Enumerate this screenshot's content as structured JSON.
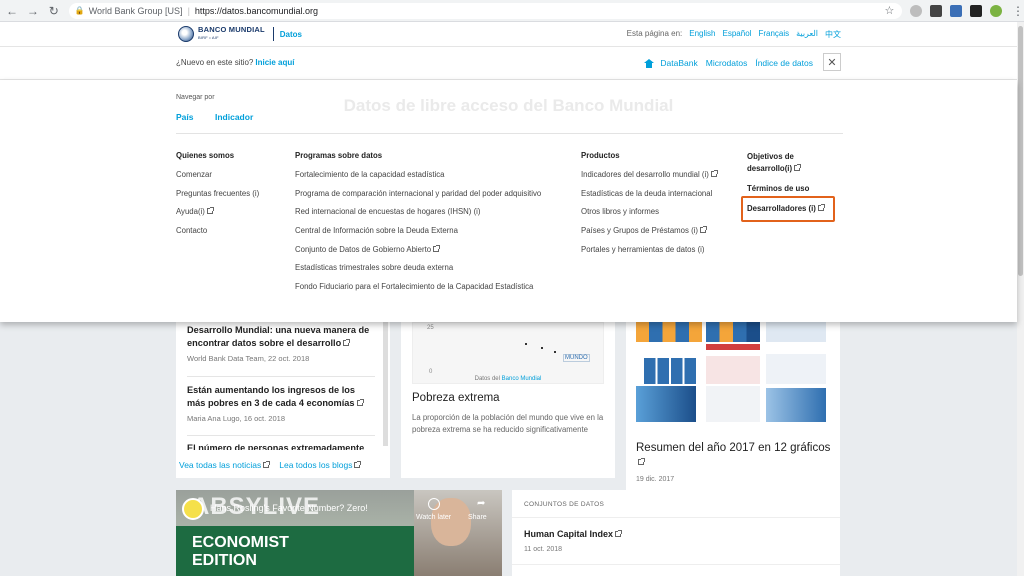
{
  "browser": {
    "tab_site": "World Bank Group [US]",
    "url": "https://datos.bancomundial.org"
  },
  "header": {
    "logo_text": "BANCO MUNDIAL",
    "logo_sub": "BIRF • AIF",
    "section": "Datos",
    "language_prompt": "Esta página en:",
    "languages": [
      "English",
      "Español",
      "Français",
      "العربية",
      "中文"
    ]
  },
  "subheader": {
    "new_prompt": "¿Nuevo en este sitio?",
    "start_link": "Inicie aquí",
    "quick_links": [
      "DataBank",
      "Microdatos",
      "Índice de datos"
    ],
    "close_glyph": "✕"
  },
  "mega_menu": {
    "ghost_title": "Datos de libre acceso del Banco Mundial",
    "browse_label": "Navegar por",
    "browse_tabs": [
      "País",
      "Indicador"
    ],
    "columns": [
      {
        "heading": "Quienes somos",
        "items": [
          "Comenzar",
          "Preguntas frecuentes (i)",
          "Ayuda(i)",
          "Contacto"
        ]
      },
      {
        "heading": "Programas sobre datos",
        "items": [
          "Fortalecimiento de la capacidad estadística",
          "Programa de comparación internacional y paridad del poder adquisitivo",
          "Red internacional de encuestas de hogares (IHSN) (i)",
          "Central de Información sobre la Deuda Externa",
          "Conjunto de Datos de Gobierno Abierto",
          "Estadísticas trimestrales sobre deuda externa",
          "Fondo Fiduciario para el Fortalecimiento de la Capacidad Estadística"
        ]
      },
      {
        "heading": "Productos",
        "items": [
          "Indicadores del desarrollo mundial (i)",
          "Estadísticas de la deuda internacional",
          "Otros libros y informes",
          "Países y Grupos de Préstamos (i)",
          "Portales y herramientas de datos (i)"
        ]
      }
    ],
    "col4": {
      "objetivos_line1": "Objetivos de",
      "objetivos_line2": "desarrollo(i)",
      "terminos": "Términos de uso",
      "desarrolladores": "Desarrolladores (i)"
    }
  },
  "news": {
    "items": [
      {
        "title": "Desarrollo Mundial: una nueva manera de encontrar datos sobre el desarrollo",
        "meta": "World Bank Data Team, 22 oct. 2018"
      },
      {
        "title": "Están aumentando los ingresos de los más pobres en 3 de cada 4 economías",
        "meta": "Maria Ana Lugo, 16 oct. 2018"
      },
      {
        "title": "El número de personas extremadamente",
        "meta": ""
      }
    ],
    "all_news": "Vea todas las noticias",
    "all_blogs": "Lea todos los blogs"
  },
  "poverty": {
    "title": "Pobreza extrema",
    "desc": "La proporción de la población del mundo que vive en la pobreza extrema se ha reducido significativamente",
    "chart_caption_prefix": "Datos del",
    "chart_caption_link": "Banco Mundial",
    "chart_tick_25": "25",
    "chart_tick_0": "0",
    "chart_label": "MUNDO"
  },
  "resumen": {
    "title": "Resumen del año 2017 en 12 gráficos",
    "date": "19 dic. 2017"
  },
  "video": {
    "title": "Hans Rosling's Favorite Number? Zero!",
    "brand": "ABSYLIVE",
    "economist_line1": "ECONOMIST",
    "economist_line2": "EDITION",
    "watch_later": "Watch later",
    "share": "Share"
  },
  "datasets": {
    "label": "CONJUNTOS DE DATOS",
    "title": "Human Capital Index",
    "date": "11 oct. 2018"
  },
  "colors": {
    "accent": "#009fda",
    "highlight": "#e2621b",
    "brand_navy": "#1a3a6b"
  }
}
